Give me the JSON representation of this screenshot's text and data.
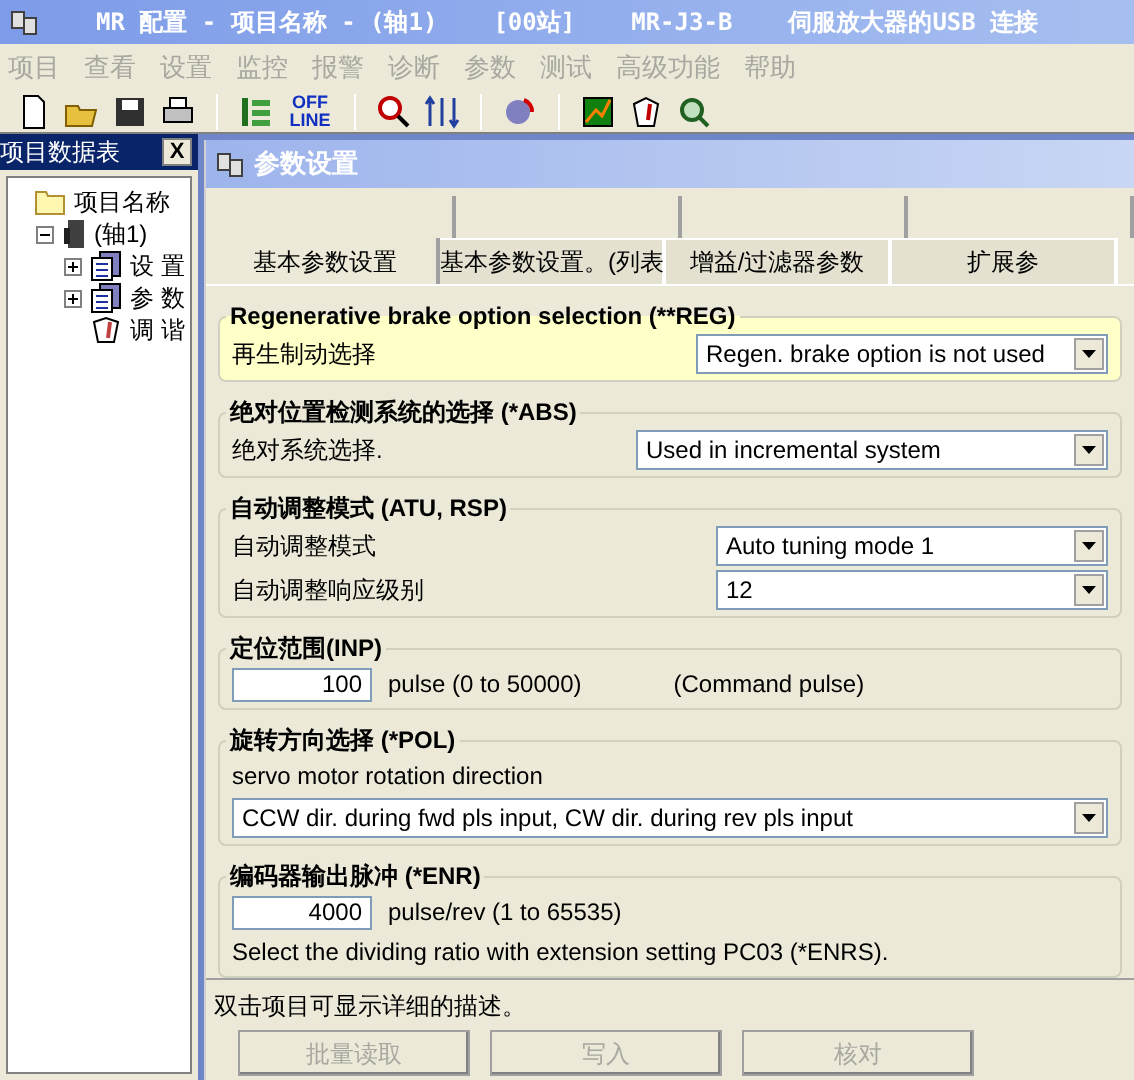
{
  "window": {
    "title_parts": [
      "MR 配置 - 项目名称 - (轴1)",
      "[00站]",
      "MR-J3-B",
      "伺服放大器的USB 连接"
    ]
  },
  "menu": [
    {
      "label": "项目",
      "disabled": true
    },
    {
      "label": "查看",
      "disabled": true
    },
    {
      "label": "设置",
      "disabled": true
    },
    {
      "label": "监控",
      "disabled": true
    },
    {
      "label": "报警",
      "disabled": true
    },
    {
      "label": "诊断",
      "disabled": true
    },
    {
      "label": "参数",
      "disabled": true
    },
    {
      "label": "测试",
      "disabled": true
    },
    {
      "label": "高级功能",
      "disabled": true
    },
    {
      "label": "帮助",
      "disabled": true
    }
  ],
  "toolbar": {
    "offline_label": "OFF LINE"
  },
  "project_panel": {
    "title": "项目数据表",
    "close": "X",
    "tree": [
      {
        "label": "项目名称",
        "kind": "folder",
        "children": [
          {
            "label": "(轴1)",
            "kind": "drive",
            "expanded": true,
            "children": [
              {
                "label": "设 置",
                "kind": "pages",
                "expanded": false
              },
              {
                "label": "参 数",
                "kind": "pages",
                "expanded": false
              },
              {
                "label": "调 谐",
                "kind": "leaf"
              }
            ]
          }
        ]
      }
    ]
  },
  "param_window": {
    "title": "参数设置",
    "tabs": [
      {
        "label": "基本参数设置",
        "selected": true
      },
      {
        "label": "基本参数设置。(列表",
        "selected": false
      },
      {
        "label": "增益/过滤器参数",
        "selected": false
      },
      {
        "label": "扩展参",
        "selected": false
      }
    ],
    "groups": [
      {
        "title": "Regenerative brake option selection (**REG)",
        "selected": true,
        "rows": [
          {
            "kind": "select",
            "label": "再生制动选择",
            "value": "Regen. brake option is not used"
          }
        ]
      },
      {
        "title": "绝对位置检测系统的选择 (*ABS)",
        "selected": false,
        "rows": [
          {
            "kind": "select",
            "label": "绝对系统选择.",
            "value": "Used in incremental system"
          }
        ]
      },
      {
        "title": "自动调整模式 (ATU, RSP)",
        "selected": false,
        "rows": [
          {
            "kind": "select",
            "label": "自动调整模式",
            "value": "Auto tuning mode 1"
          },
          {
            "kind": "select",
            "label": "自动调整响应级别",
            "value": "12"
          }
        ]
      },
      {
        "title": "定位范围(INP)",
        "selected": false,
        "rows": [
          {
            "kind": "number",
            "value": "100",
            "unit": "pulse (0 to 50000)",
            "note": "(Command pulse)"
          }
        ]
      },
      {
        "title": "旋转方向选择 (*POL)",
        "selected": false,
        "rows": [
          {
            "kind": "text",
            "text": "servo motor rotation direction"
          },
          {
            "kind": "select",
            "value": "CCW dir. during fwd pls input, CW dir. during rev pls input"
          }
        ]
      },
      {
        "title": "编码器输出脉冲 (*ENR)",
        "selected": false,
        "rows": [
          {
            "kind": "number",
            "value": "4000",
            "unit": "pulse/rev (1 to 65535)"
          },
          {
            "kind": "text",
            "text": "Select the dividing ratio with extension setting PC03 (*ENRS)."
          }
        ]
      }
    ],
    "hint": "双击项目可显示详细的描述。",
    "buttons": [
      {
        "label": "批量读取",
        "disabled": true
      },
      {
        "label": "写入",
        "disabled": true
      },
      {
        "label": "核对",
        "disabled": true
      }
    ]
  }
}
